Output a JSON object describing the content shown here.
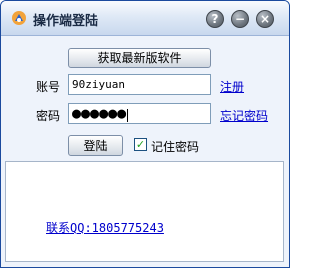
{
  "window": {
    "title": "操作端登陆",
    "buttons": {
      "help": "?",
      "minimize": "−",
      "close": "×"
    }
  },
  "form": {
    "fetch_latest_label": "获取最新版软件",
    "account_label": "账号",
    "account_value": "90ziyuan",
    "register_link": "注册",
    "password_label": "密码",
    "password_masked": "●●●●●●",
    "forgot_password_link": "忘记密码",
    "login_button": "登陆",
    "remember_checked": true,
    "remember_label": "记住密码"
  },
  "footer": {
    "contact_text": "联系QQ:1805775243"
  },
  "colors": {
    "title_bar": "#dfe9f6",
    "link": "#0000cc",
    "checkmark": "#21a121"
  }
}
